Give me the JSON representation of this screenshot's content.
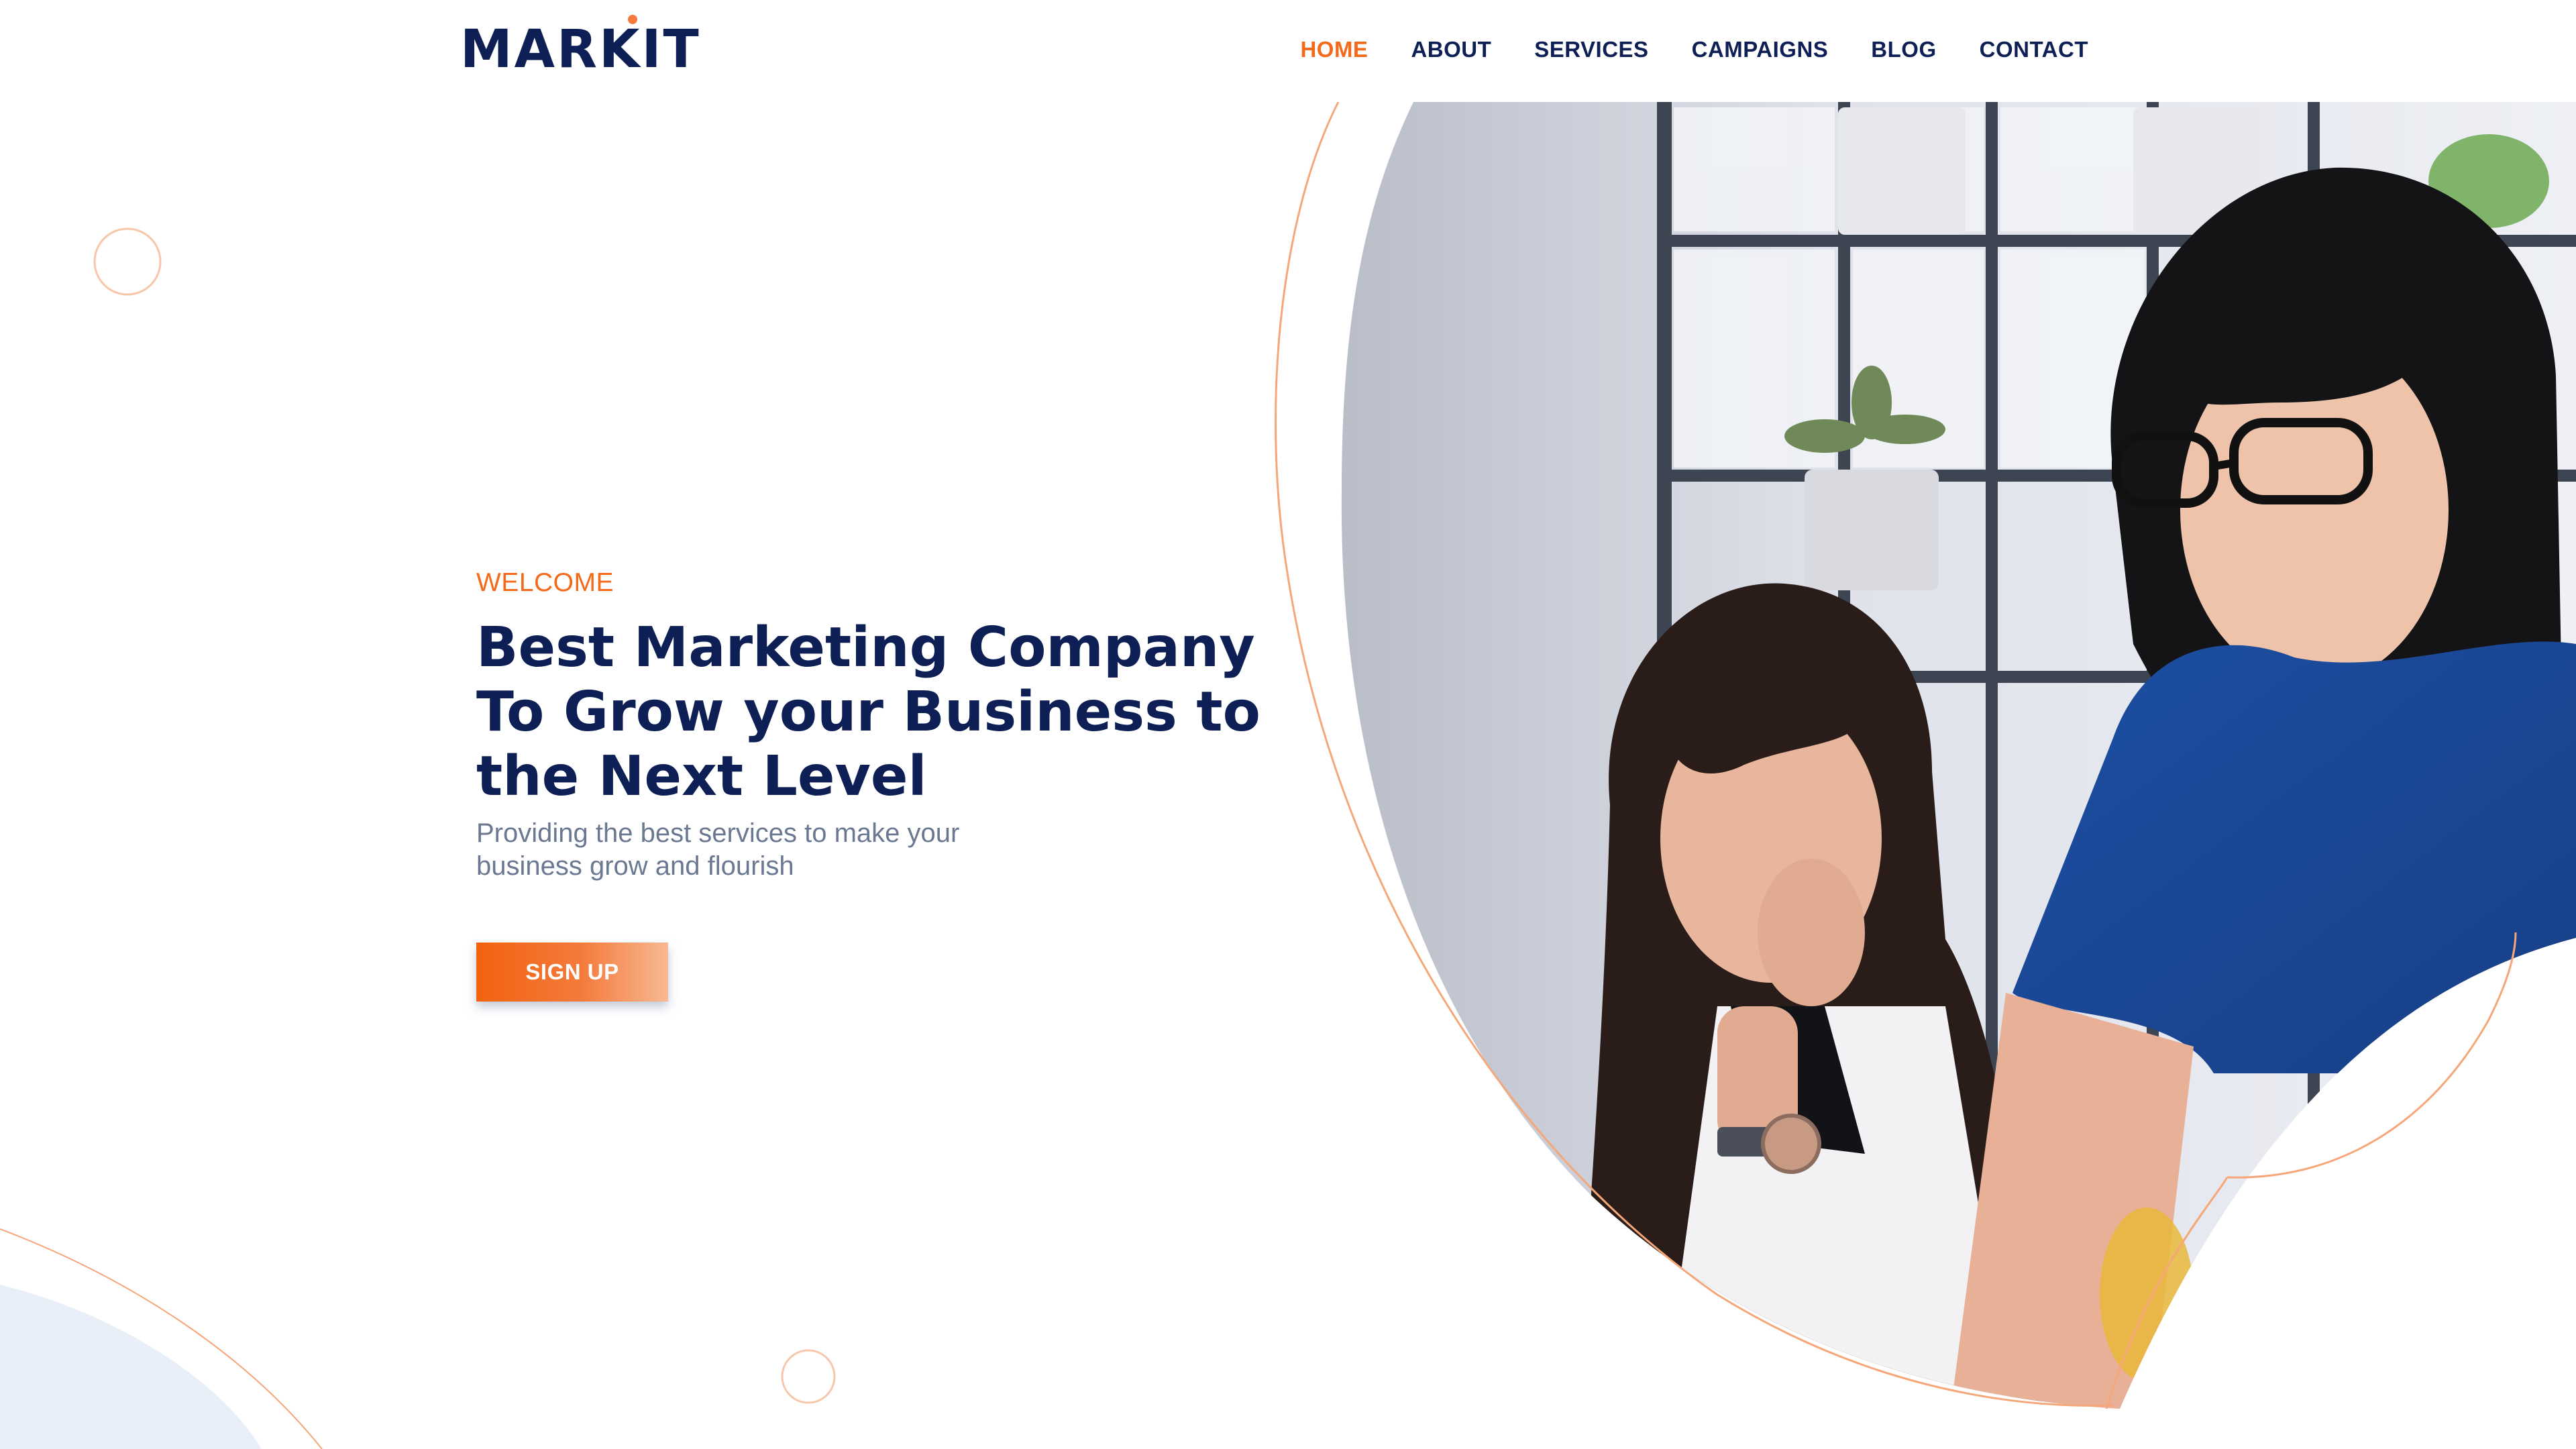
{
  "header": {
    "logo_text": "MARKIT",
    "nav": [
      {
        "label": "HOME",
        "active": true
      },
      {
        "label": "ABOUT",
        "active": false
      },
      {
        "label": "SERVICES",
        "active": false
      },
      {
        "label": "CAMPAIGNS",
        "active": false
      },
      {
        "label": "BLOG",
        "active": false
      },
      {
        "label": "CONTACT",
        "active": false
      }
    ]
  },
  "hero": {
    "eyebrow": "WELCOME",
    "headline_line1": "Best Marketing Company",
    "headline_line2": "To Grow your Business to",
    "headline_line3": "the Next Level",
    "subtext_line1": "Providing the best services to make your",
    "subtext_line2": "business grow and flourish",
    "cta_label": "SIGN UP",
    "image_alt": "Two women working together at a desk"
  },
  "colors": {
    "brand_navy": "#0d1f55",
    "accent_orange": "#f26a1a",
    "muted_text": "#6a7891",
    "soft_blue": "#e8eef8"
  }
}
